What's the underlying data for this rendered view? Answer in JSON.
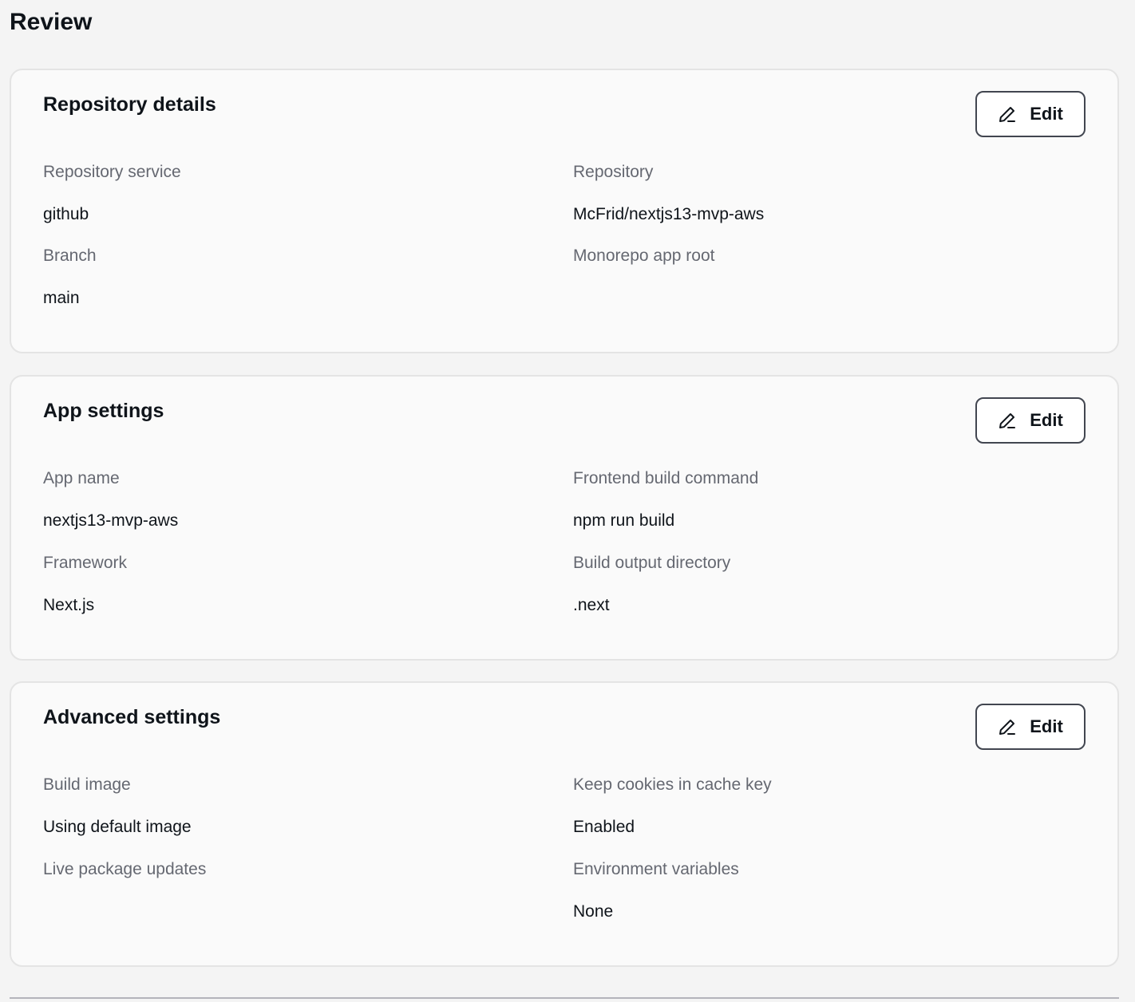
{
  "page": {
    "title": "Review"
  },
  "sections": [
    {
      "title": "Repository details",
      "edit_label": "Edit",
      "fields": [
        {
          "label": "Repository service",
          "value": "github"
        },
        {
          "label": "Repository",
          "value": "McFrid/nextjs13-mvp-aws"
        },
        {
          "label": "Branch",
          "value": "main"
        },
        {
          "label": "Monorepo app root",
          "value": ""
        }
      ]
    },
    {
      "title": "App settings",
      "edit_label": "Edit",
      "fields": [
        {
          "label": "App name",
          "value": "nextjs13-mvp-aws"
        },
        {
          "label": "Frontend build command",
          "value": "npm run build"
        },
        {
          "label": "Framework",
          "value": "Next.js"
        },
        {
          "label": "Build output directory",
          "value": ".next"
        }
      ]
    },
    {
      "title": "Advanced settings",
      "edit_label": "Edit",
      "fields": [
        {
          "label": "Build image",
          "value": "Using default image"
        },
        {
          "label": "Keep cookies in cache key",
          "value": "Enabled"
        },
        {
          "label": "Live package updates",
          "value": ""
        },
        {
          "label": "Environment variables",
          "value": "None"
        }
      ]
    }
  ],
  "icons": {
    "edit": "pencil-icon"
  },
  "colors": {
    "background": "#f4f4f4",
    "card_background": "#fafafa",
    "card_border": "#e4e4e4",
    "label_text": "#656871",
    "value_text": "#0f141a",
    "button_border": "#424650"
  }
}
